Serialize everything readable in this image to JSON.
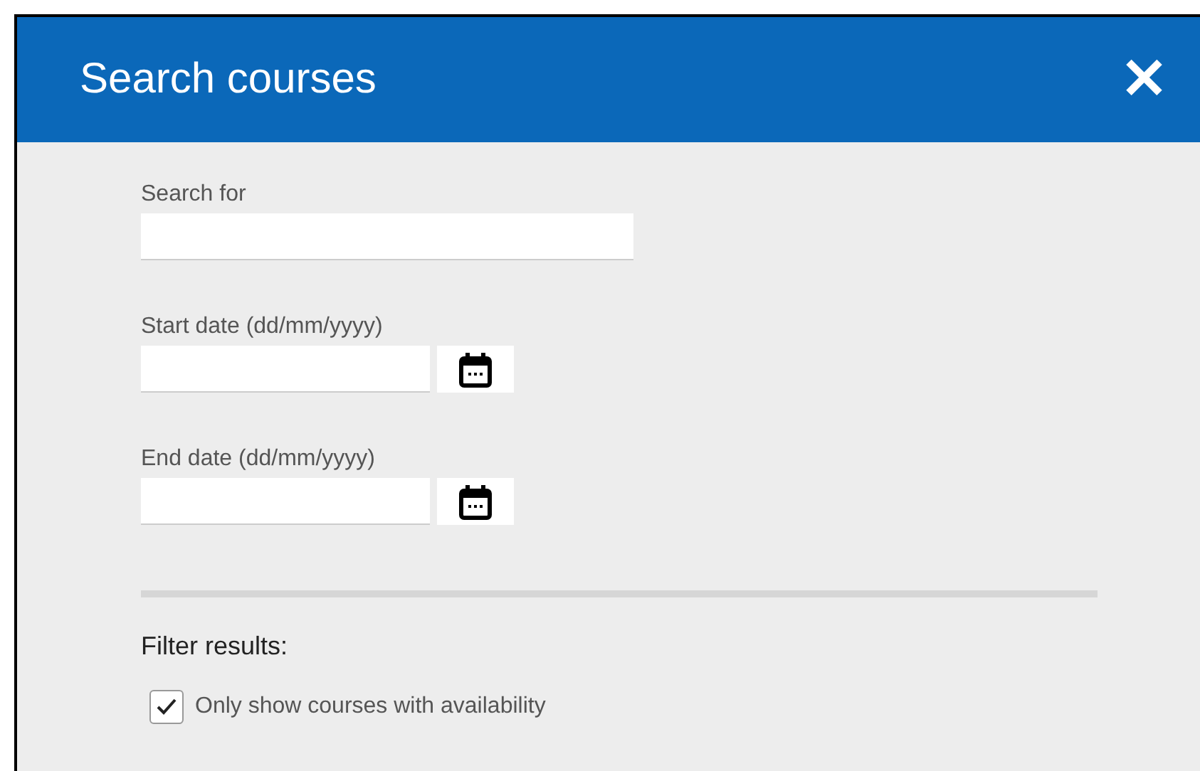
{
  "dialog": {
    "title": "Search courses",
    "close": "✕"
  },
  "fields": [
    {
      "kind": "text",
      "label": "Search for"
    },
    {
      "kind": "date",
      "label": "Start date (dd/mm/yyyy)"
    },
    {
      "kind": "date",
      "label": "End date (dd/mm/yyyy)"
    }
  ],
  "filter": {
    "heading": "Filter results:",
    "options": [
      {
        "label": "Only show courses with availability",
        "checked": true
      }
    ]
  }
}
